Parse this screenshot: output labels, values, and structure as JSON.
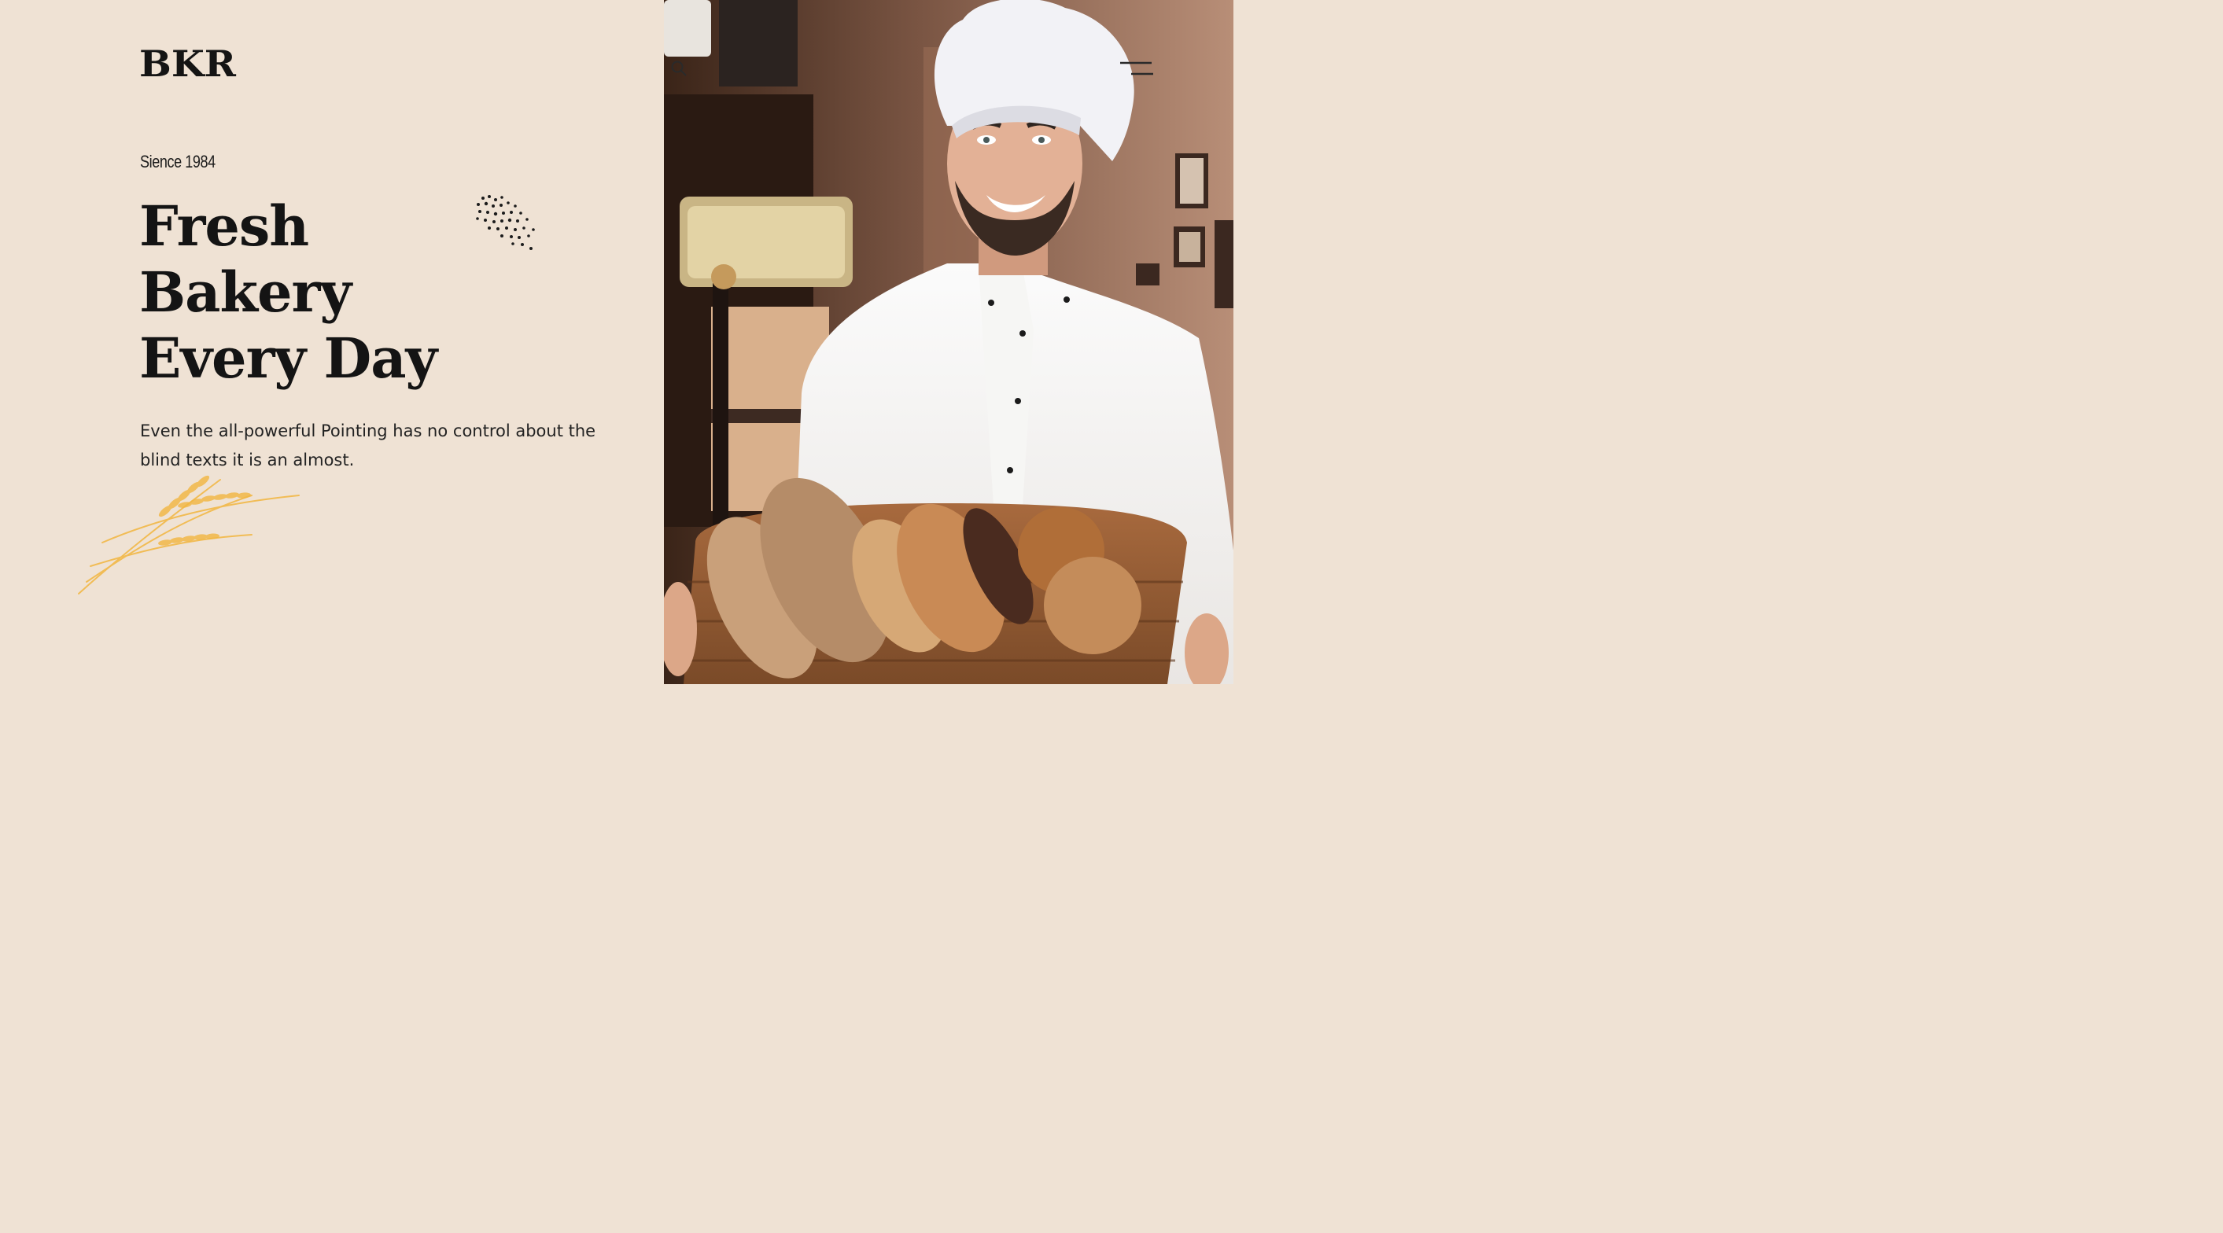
{
  "brand": {
    "logo_text": "BKR"
  },
  "hero": {
    "since": "Sience 1984",
    "headline_lines": [
      "Fresh",
      "Bakery",
      "Every Day"
    ],
    "description": "Even the all-powerful Pointing has no control about the blind texts it is an almost."
  },
  "header": {
    "search_icon": "search-icon",
    "menu_icon": "hamburger-menu-icon"
  },
  "image": {
    "subject": "smiling baker in chef hat holding basket of bread"
  },
  "colors": {
    "background": "#efe2d4",
    "text": "#141414",
    "wheat": "#f2b640"
  }
}
